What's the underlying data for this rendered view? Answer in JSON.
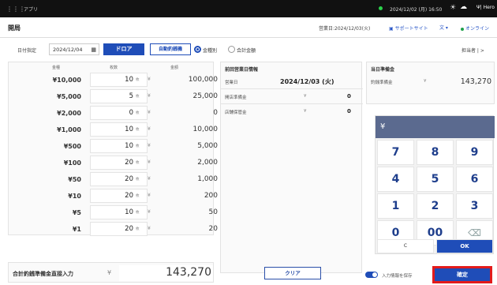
{
  "topbar": {
    "apps_icon": "grid-icon",
    "app_name": "アプリ",
    "datetime": "2024/12/02 (月) 16:50",
    "weather_icon": "sun-icon",
    "cloud_icon": "cloud-icon",
    "brand": "Ψ| Hero"
  },
  "header": {
    "title": "開局",
    "business_date": "営業日:2024/12/03(火)",
    "support": "サポートサイト",
    "language": "文 ▾",
    "online": "オンライン"
  },
  "controls": {
    "date_label": "日付指定",
    "date_value": "2024/12/04",
    "drawer_button": "ドロア",
    "auto_button": "自動釣銭機",
    "radio_by_denom": "金種別",
    "radio_total": "合計金額",
    "person": "担当者 | >"
  },
  "table": {
    "headers": {
      "denomination": "金種",
      "count": "枚数",
      "amount": "金額"
    },
    "unit": "枚",
    "yen": "¥",
    "rows": [
      {
        "denom": "¥10,000",
        "qty": "10",
        "amount": "100,000"
      },
      {
        "denom": "¥5,000",
        "qty": "5",
        "amount": "25,000"
      },
      {
        "denom": "¥2,000",
        "qty": "0",
        "amount": "0"
      },
      {
        "denom": "¥1,000",
        "qty": "10",
        "amount": "10,000"
      },
      {
        "denom": "¥500",
        "qty": "10",
        "amount": "5,000"
      },
      {
        "denom": "¥100",
        "qty": "20",
        "amount": "2,000"
      },
      {
        "denom": "¥50",
        "qty": "20",
        "amount": "1,000"
      },
      {
        "denom": "¥10",
        "qty": "20",
        "amount": "200"
      },
      {
        "denom": "¥5",
        "qty": "10",
        "amount": "50"
      },
      {
        "denom": "¥1",
        "qty": "20",
        "amount": "20"
      }
    ]
  },
  "prev_day": {
    "title": "前回営業日情報",
    "business_day_label": "営業日",
    "business_day_value": "2024/12/03 (火)",
    "opening_reserve_label": "開店準備金",
    "opening_reserve_yen": "¥",
    "opening_reserve_value": "0",
    "store_storage_label": "店舗保管金",
    "store_storage_yen": "¥",
    "store_storage_value": "0"
  },
  "today": {
    "title": "当日準備金",
    "change_reserve_label": "釣銭準備金",
    "yen": "¥",
    "change_reserve_value": "143,270"
  },
  "keypad": {
    "display": "¥",
    "keys": [
      "7",
      "8",
      "9",
      "4",
      "5",
      "6",
      "1",
      "2",
      "3",
      "0",
      "00"
    ],
    "backspace_icon": "backspace-icon",
    "clear_key": "C",
    "ok_key": "OK"
  },
  "bottom": {
    "total_label": "合計釣銭準備金直接入力",
    "yen": "¥",
    "total_value": "143,270"
  },
  "actions": {
    "clear": "クリア",
    "save_toggle_label": "入力情報を保存",
    "confirm": "確定"
  },
  "colors": {
    "primary": "#1f4db8",
    "highlight": "#e31b1b",
    "keypad_display": "#5b6a8f",
    "online": "#1ea04a"
  }
}
